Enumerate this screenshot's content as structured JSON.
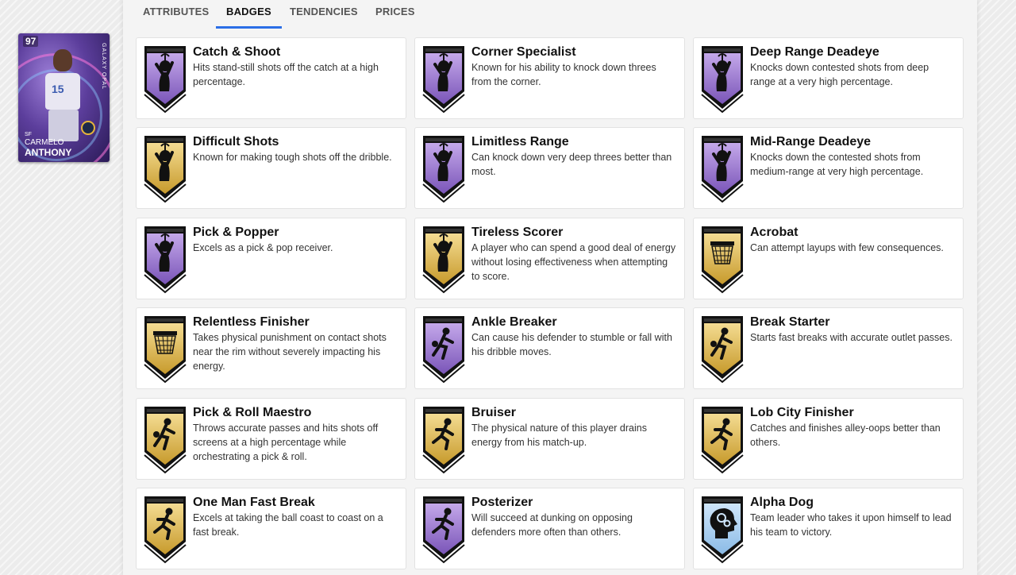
{
  "tabs": [
    {
      "label": "ATTRIBUTES",
      "active": false
    },
    {
      "label": "BADGES",
      "active": true
    },
    {
      "label": "TENDENCIES",
      "active": false
    },
    {
      "label": "PRICES",
      "active": false
    }
  ],
  "player_card": {
    "rating": "97",
    "position": "SF",
    "first_name": "CARMELO",
    "last_name": "ANTHONY",
    "jersey_number": "15",
    "tier_label": "GALAXY OPAL"
  },
  "tier_colors": {
    "purple": {
      "top": "#c4a8ea",
      "bottom": "#7a55b8"
    },
    "gold": {
      "top": "#f4dc92",
      "bottom": "#c79a2c"
    },
    "blue": {
      "top": "#cfe6fb",
      "bottom": "#8bbbe6"
    }
  },
  "badges": [
    {
      "name": "Catch & Shoot",
      "description": "Hits stand-still shots off the catch at a high percentage.",
      "tier": "purple",
      "icon": "shooter-icon"
    },
    {
      "name": "Corner Specialist",
      "description": "Known for his ability to knock down threes from the corner.",
      "tier": "purple",
      "icon": "shooter-icon"
    },
    {
      "name": "Deep Range Deadeye",
      "description": "Knocks down contested shots from deep range at a very high percentage.",
      "tier": "purple",
      "icon": "shooter-icon"
    },
    {
      "name": "Difficult Shots",
      "description": "Known for making tough shots off the dribble.",
      "tier": "gold",
      "icon": "shooter-icon"
    },
    {
      "name": "Limitless Range",
      "description": "Can knock down very deep threes better than most.",
      "tier": "purple",
      "icon": "shooter-icon"
    },
    {
      "name": "Mid-Range Deadeye",
      "description": "Knocks down the contested shots from medium-range at very high percentage.",
      "tier": "purple",
      "icon": "shooter-icon"
    },
    {
      "name": "Pick & Popper",
      "description": "Excels as a pick & pop receiver.",
      "tier": "purple",
      "icon": "shooter-icon"
    },
    {
      "name": "Tireless Scorer",
      "description": "A player who can spend a good deal of energy without losing effectiveness when attempting to score.",
      "tier": "gold",
      "icon": "shooter-icon"
    },
    {
      "name": "Acrobat",
      "description": "Can attempt layups with few consequences.",
      "tier": "gold",
      "icon": "hoop-icon"
    },
    {
      "name": "Relentless Finisher",
      "description": "Takes physical punishment on contact shots near the rim without severely impacting his energy.",
      "tier": "gold",
      "icon": "hoop-icon"
    },
    {
      "name": "Ankle Breaker",
      "description": "Can cause his defender to stumble or fall with his dribble moves.",
      "tier": "purple",
      "icon": "dribbler-icon"
    },
    {
      "name": "Break Starter",
      "description": "Starts fast breaks with accurate outlet passes.",
      "tier": "gold",
      "icon": "dribbler-icon"
    },
    {
      "name": "Pick & Roll Maestro",
      "description": "Throws accurate passes and hits shots off screens at a high percentage while orchestrating a pick & roll.",
      "tier": "gold",
      "icon": "dribbler-icon"
    },
    {
      "name": "Bruiser",
      "description": "The physical nature of this player drains energy from his match-up.",
      "tier": "gold",
      "icon": "runner-icon"
    },
    {
      "name": "Lob City Finisher",
      "description": "Catches and finishes alley-oops better than others.",
      "tier": "gold",
      "icon": "runner-icon"
    },
    {
      "name": "One Man Fast Break",
      "description": "Excels at taking the ball coast to coast on a fast break.",
      "tier": "gold",
      "icon": "runner-icon"
    },
    {
      "name": "Posterizer",
      "description": "Will succeed at dunking on opposing defenders more often than others.",
      "tier": "purple",
      "icon": "runner-icon"
    },
    {
      "name": "Alpha Dog",
      "description": "Team leader who takes it upon himself to lead his team to victory.",
      "tier": "blue",
      "icon": "brain-gears-icon"
    }
  ]
}
